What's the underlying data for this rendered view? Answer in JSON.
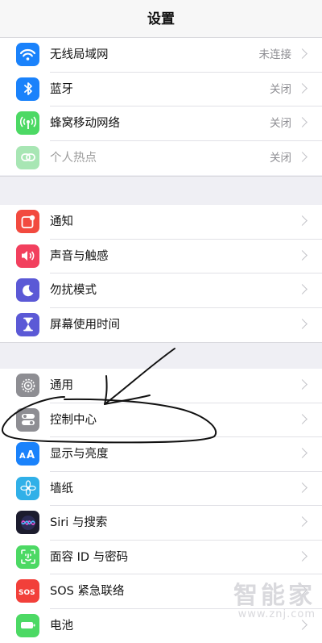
{
  "nav": {
    "title": "设置"
  },
  "groups": [
    {
      "rows": [
        {
          "icon": "wifi-icon",
          "label": "无线局域网",
          "value": "未连接",
          "color": "#1a82fb"
        },
        {
          "icon": "bluetooth-icon",
          "label": "蓝牙",
          "value": "关闭",
          "color": "#1a82fb"
        },
        {
          "icon": "cellular-icon",
          "label": "蜂窝移动网络",
          "value": "关闭",
          "color": "#4cd964"
        },
        {
          "icon": "hotspot-icon",
          "label": "个人热点",
          "value": "关闭",
          "color": "#a8e6b4",
          "disabled": true
        }
      ]
    },
    {
      "rows": [
        {
          "icon": "notifications-icon",
          "label": "通知",
          "color": "#f24a3f"
        },
        {
          "icon": "sounds-icon",
          "label": "声音与触感",
          "color": "#f2405e"
        },
        {
          "icon": "do-not-disturb-icon",
          "label": "勿扰模式",
          "color": "#5b59d6"
        },
        {
          "icon": "screen-time-icon",
          "label": "屏幕使用时间",
          "color": "#5b59d6"
        }
      ]
    },
    {
      "rows": [
        {
          "icon": "gear-icon",
          "label": "通用",
          "color": "#8e8e93"
        },
        {
          "icon": "control-center-icon",
          "label": "控制中心",
          "color": "#8e8e93"
        },
        {
          "icon": "display-brightness-icon",
          "label": "显示与亮度",
          "color": "#1a82fb"
        },
        {
          "icon": "wallpaper-icon",
          "label": "墙纸",
          "color": "#30b0e8"
        },
        {
          "icon": "siri-icon",
          "label": "Siri 与搜索",
          "color": "#222"
        },
        {
          "icon": "face-id-icon",
          "label": "面容 ID 与密码",
          "color": "#4cd964"
        },
        {
          "icon": "sos-icon",
          "label": "SOS 紧急联络",
          "color": "#f2403a"
        },
        {
          "icon": "battery-icon",
          "label": "电池",
          "color": "#4cd964"
        }
      ]
    }
  ],
  "watermark": {
    "brand": "智能家",
    "url": "www.znj.com"
  }
}
